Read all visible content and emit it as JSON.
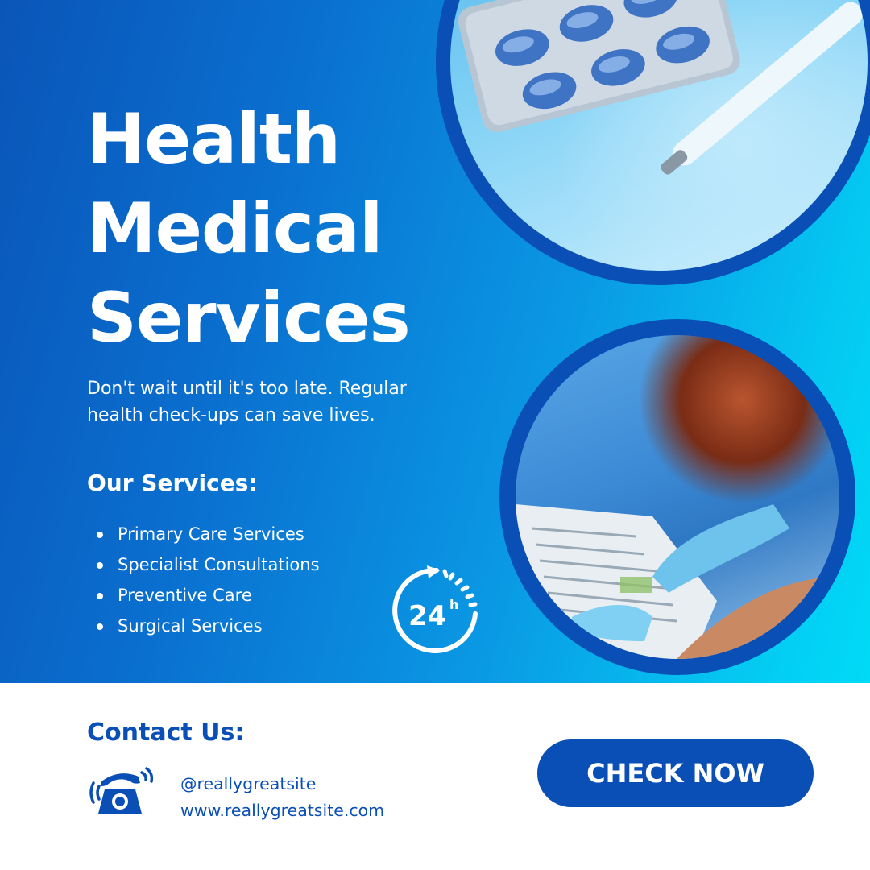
{
  "hero": {
    "title_lines": [
      "Health",
      "Medical",
      "Services"
    ],
    "tagline": "Don't wait until it's too late. Regular health check-ups can save lives.",
    "services_heading": "Our Services:",
    "services": [
      "Primary Care Services",
      "Specialist Consultations",
      "Preventive Care",
      "Surgical Services"
    ],
    "badge_number": "24",
    "badge_unit": "h",
    "badge_icon": "24h-clock-icon",
    "top_photo": "pills-and-thermometer-photo",
    "bottom_photo": "gloved-hand-pointing-at-document-photo"
  },
  "footer": {
    "contact_heading": "Contact Us:",
    "contact_icon": "telephone-icon",
    "social_handle": "@reallygreatsite",
    "website": "www.reallygreatsite.com",
    "cta_label": "CHECK NOW"
  },
  "colors": {
    "primary_blue": "#0a4fb5",
    "gradient_start": "#0a55b8",
    "gradient_end": "#00dbf7",
    "white": "#ffffff"
  }
}
